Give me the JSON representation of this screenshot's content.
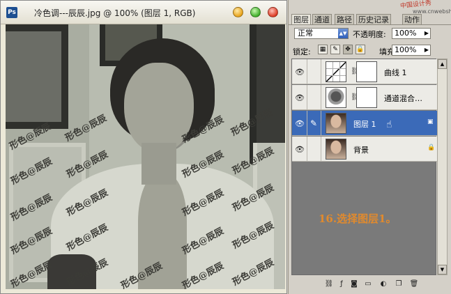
{
  "document": {
    "title": "冷色调---辰辰.jpg @ 100% (图层 1, RGB)",
    "app_icon": "Ps",
    "watermark": "形色@辰辰"
  },
  "panel": {
    "tabs": [
      "图层",
      "通道",
      "路径",
      "历史记录",
      "动作"
    ],
    "active_tab": "图层",
    "site_stamp": "中国设计秀",
    "site_url": "www.cnwebshow.com",
    "blend_mode": "正常",
    "opacity_label": "不透明度:",
    "opacity_value": "100%",
    "lock_label": "锁定:",
    "fill_label": "填充:",
    "fill_value": "100%",
    "layers": [
      {
        "name": "曲线 1",
        "type": "curves",
        "has_mask": true,
        "selected": false
      },
      {
        "name": "通道混合…",
        "type": "channel-mixer",
        "has_mask": true,
        "selected": false
      },
      {
        "name": "图层 1",
        "type": "photo",
        "has_mask": false,
        "selected": true
      },
      {
        "name": "背景",
        "type": "photo",
        "has_mask": false,
        "selected": false,
        "locked": true
      }
    ],
    "note": "16.选择图层1。"
  },
  "icons": {
    "eye": "eye-icon",
    "brush": "brush-icon",
    "chain": "chain-icon",
    "lock": "lock-icon",
    "hand": "hand-cursor-icon"
  }
}
